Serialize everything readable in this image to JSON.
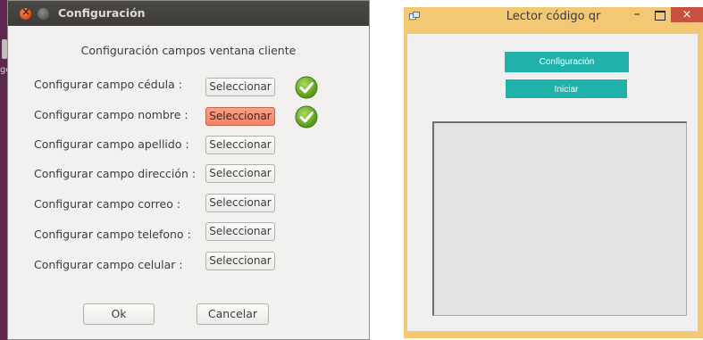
{
  "config_dialog": {
    "title": "Configuración",
    "heading": "Configuración campos ventana cliente",
    "rows": [
      {
        "label": "Configurar campo cédula :",
        "button": "Seleccionar",
        "checked": true
      },
      {
        "label": "Configurar campo nombre :",
        "button": "Seleccionar",
        "checked": true
      },
      {
        "label": "Configurar campo apellido :",
        "button": "Seleccionar",
        "checked": false
      },
      {
        "label": "Configurar campo dirección :",
        "button": "Seleccionar",
        "checked": false
      },
      {
        "label": "Configurar campo correo :",
        "button": "Seleccionar",
        "checked": false
      },
      {
        "label": "Configurar campo telefono :",
        "button": "Seleccionar",
        "checked": false
      },
      {
        "label": "Configurar campo celular :",
        "button": "Seleccionar",
        "checked": false
      }
    ],
    "ok_label": "Ok",
    "cancel_label": "Cancelar",
    "accent_active": "#ef8466"
  },
  "background_window": {
    "partial_text": "go"
  },
  "qr_window": {
    "title": "Lector código qr",
    "min_glyph": "–",
    "close_glyph": "×",
    "config_button": "Configuración",
    "start_button": "Iniciar",
    "accent_color": "#20b2aa",
    "titlebar_color": "#f3c875"
  }
}
